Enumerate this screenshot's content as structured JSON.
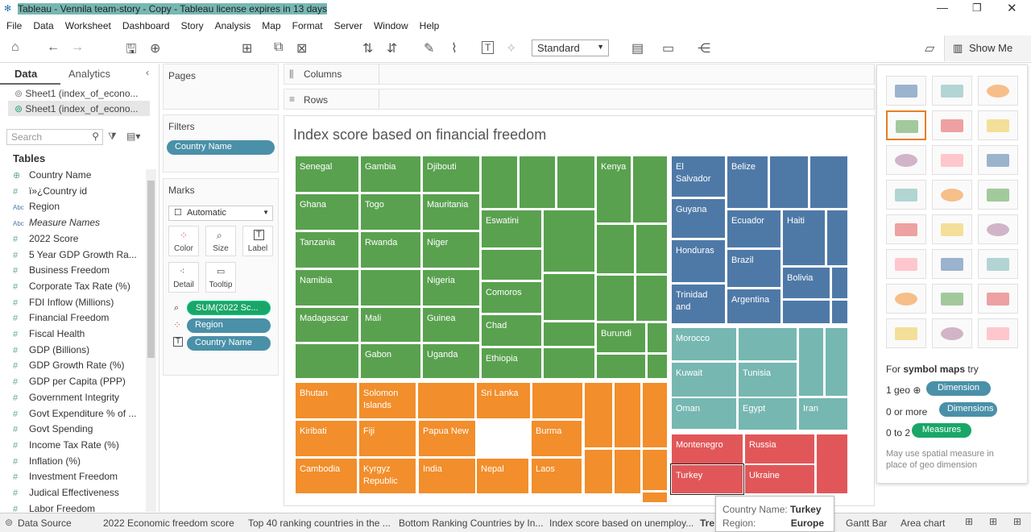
{
  "window": {
    "title": "Tableau - Vennila team-story - Copy - Tableau license expires in 13 days"
  },
  "menu": [
    "File",
    "Data",
    "Worksheet",
    "Dashboard",
    "Story",
    "Analysis",
    "Map",
    "Format",
    "Server",
    "Window",
    "Help"
  ],
  "toolbar": {
    "standard": "Standard",
    "show_me": "Show Me"
  },
  "left": {
    "tab_data": "Data",
    "tab_analytics": "Analytics",
    "sources": [
      "Sheet1 (index_of_econo...",
      "Sheet1 (index_of_econo..."
    ],
    "search_placeholder": "Search",
    "tables_label": "Tables",
    "fields": [
      {
        "icon": "⊕",
        "name": "Country Name"
      },
      {
        "icon": "#",
        "name": "ï»¿Country id"
      },
      {
        "icon": "Abc",
        "name": "Region"
      },
      {
        "icon": "Abc",
        "name": "Measure Names"
      },
      {
        "icon": "#",
        "name": "2022 Score"
      },
      {
        "icon": "#",
        "name": "5 Year GDP Growth Ra..."
      },
      {
        "icon": "#",
        "name": "Business Freedom"
      },
      {
        "icon": "#",
        "name": "Corporate Tax Rate (%)"
      },
      {
        "icon": "#",
        "name": "FDI Inflow (Millions)"
      },
      {
        "icon": "#",
        "name": "Financial Freedom"
      },
      {
        "icon": "#",
        "name": "Fiscal Health"
      },
      {
        "icon": "#",
        "name": "GDP (Billions)"
      },
      {
        "icon": "#",
        "name": "GDP Growth Rate (%)"
      },
      {
        "icon": "#",
        "name": "GDP per Capita (PPP)"
      },
      {
        "icon": "#",
        "name": "Government Integrity"
      },
      {
        "icon": "#",
        "name": "Govt Expenditure % of ..."
      },
      {
        "icon": "#",
        "name": "Govt Spending"
      },
      {
        "icon": "#",
        "name": "Income Tax Rate (%)"
      },
      {
        "icon": "#",
        "name": "Inflation (%)"
      },
      {
        "icon": "#",
        "name": "Investment Freedom"
      },
      {
        "icon": "#",
        "name": "Judical Effectiveness"
      },
      {
        "icon": "#",
        "name": "Labor Freedom"
      }
    ]
  },
  "shelves": {
    "pages": "Pages",
    "filters": "Filters",
    "filter_pill": "Country Name",
    "marks": "Marks",
    "mark_type": "Automatic",
    "mark_buttons": [
      "Color",
      "Size",
      "Label",
      "Detail",
      "Tooltip"
    ],
    "mark_pills": [
      "SUM(2022 Sc...",
      "Region",
      "Country Name"
    ],
    "columns": "Columns",
    "rows": "Rows"
  },
  "view": {
    "title": "Index score based on financial  freedom"
  },
  "treemap": [
    {
      "l": "Senegal",
      "c": "g"
    },
    {
      "l": "Gambia",
      "c": "g"
    },
    {
      "l": "Djibouti",
      "c": "g"
    },
    {
      "l": "Kenya",
      "c": "g"
    },
    {
      "l": "Ghana",
      "c": "g"
    },
    {
      "l": "Togo",
      "c": "g"
    },
    {
      "l": "Mauritania",
      "c": "g"
    },
    {
      "l": "Tanzania",
      "c": "g"
    },
    {
      "l": "Rwanda",
      "c": "g"
    },
    {
      "l": "Niger",
      "c": "g"
    },
    {
      "l": "Eswatini",
      "c": "g"
    },
    {
      "l": "Namibia",
      "c": "g"
    },
    {
      "l": "Nigeria",
      "c": "g"
    },
    {
      "l": "Madagascar",
      "c": "g"
    },
    {
      "l": "Mali",
      "c": "g"
    },
    {
      "l": "Guinea",
      "c": "g"
    },
    {
      "l": "Comoros",
      "c": "g"
    },
    {
      "l": "Chad",
      "c": "g"
    },
    {
      "l": "Burundi",
      "c": "g"
    },
    {
      "l": "Gabon",
      "c": "g"
    },
    {
      "l": "Uganda",
      "c": "g"
    },
    {
      "l": "Ethiopia",
      "c": "g"
    },
    {
      "l": "El Salvador",
      "c": "b"
    },
    {
      "l": "Belize",
      "c": "b"
    },
    {
      "l": "Guyana",
      "c": "b"
    },
    {
      "l": "Ecuador",
      "c": "b"
    },
    {
      "l": "Haiti",
      "c": "b"
    },
    {
      "l": "Honduras",
      "c": "b"
    },
    {
      "l": "Brazil",
      "c": "b"
    },
    {
      "l": "Bolivia",
      "c": "b"
    },
    {
      "l": "Trinidad and",
      "c": "b"
    },
    {
      "l": "Argentina",
      "c": "b"
    },
    {
      "l": "Morocco",
      "c": "t"
    },
    {
      "l": "Kuwait",
      "c": "t"
    },
    {
      "l": "Tunisia",
      "c": "t"
    },
    {
      "l": "Oman",
      "c": "t"
    },
    {
      "l": "Egypt",
      "c": "t"
    },
    {
      "l": "Iran",
      "c": "t"
    },
    {
      "l": "Bhutan",
      "c": "o"
    },
    {
      "l": "Solomon Islands",
      "c": "o"
    },
    {
      "l": "Sri Lanka",
      "c": "o"
    },
    {
      "l": "Kiribati",
      "c": "o"
    },
    {
      "l": "Fiji",
      "c": "o"
    },
    {
      "l": "Papua New",
      "c": "o"
    },
    {
      "l": "Burma",
      "c": "o"
    },
    {
      "l": "Cambodia",
      "c": "o"
    },
    {
      "l": "Kyrgyz Republic",
      "c": "o"
    },
    {
      "l": "India",
      "c": "o"
    },
    {
      "l": "Nepal",
      "c": "o"
    },
    {
      "l": "Laos",
      "c": "o"
    },
    {
      "l": "Montenegro",
      "c": "r"
    },
    {
      "l": "Russia",
      "c": "r"
    },
    {
      "l": "Turkey",
      "c": "r"
    },
    {
      "l": "Ukraine",
      "c": "r"
    }
  ],
  "showme": {
    "hint_prefix": "For ",
    "hint_bold": "symbol maps",
    "hint_suffix": " try",
    "rows": [
      {
        "q": "1 geo",
        "pill": "Dimension"
      },
      {
        "q": "0 or more",
        "pill": "Dimensions"
      },
      {
        "q": "0 to 2",
        "pill": "Measures"
      }
    ],
    "note": "May use spatial measure in place of geo dimension"
  },
  "tooltip": {
    "k1": "Country Name:",
    "v1": "Turkey",
    "k2": "Region:",
    "v2": "Europe"
  },
  "bottom_tabs": [
    "Data Source",
    "2022 Economic  freedom score",
    "Top 40 ranking  countries in the ...",
    "Bottom Ranking  Countries by In...",
    "Index score based on unemploy...",
    "Tre",
    "Gantt Bar",
    "Area chart"
  ]
}
